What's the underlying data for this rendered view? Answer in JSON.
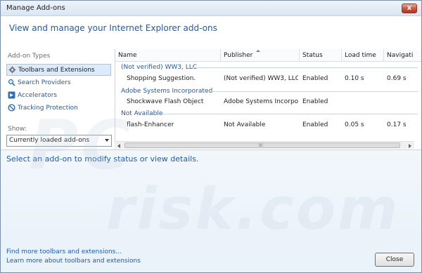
{
  "window": {
    "title": "Manage Add-ons",
    "close_glyph": "x"
  },
  "header": {
    "title": "View and manage your Internet Explorer add-ons"
  },
  "left_panel": {
    "types_label": "Add-on Types",
    "items": [
      {
        "label": "Toolbars and Extensions",
        "icon": "gear-icon",
        "selected": true
      },
      {
        "label": "Search Providers",
        "icon": "search-icon",
        "selected": false
      },
      {
        "label": "Accelerators",
        "icon": "accelerator-icon",
        "selected": false
      },
      {
        "label": "Tracking Protection",
        "icon": "block-icon",
        "selected": false
      }
    ],
    "show_label": "Show:",
    "show_select": "Currently loaded add-ons"
  },
  "list": {
    "columns": [
      "Name",
      "Publisher",
      "Status",
      "Load time",
      "Navigati"
    ],
    "groups": [
      {
        "name": "(Not verified) WW3, LLC",
        "rows": [
          {
            "name": "Shopping Suggestion.",
            "publisher": "(Not verified) WW3, LLC",
            "status": "Enabled",
            "load_time": "0.10 s",
            "navigation": "0.69 s"
          }
        ]
      },
      {
        "name": "Adobe Systems Incorporated",
        "rows": [
          {
            "name": "Shockwave Flash Object",
            "publisher": "Adobe Systems Incorpor...",
            "status": "Enabled",
            "load_time": "",
            "navigation": ""
          }
        ]
      },
      {
        "name": "Not Available",
        "rows": [
          {
            "name": "flash-Enhancer",
            "publisher": "Not Available",
            "status": "Enabled",
            "load_time": "0.05 s",
            "navigation": "0.17 s"
          }
        ]
      }
    ],
    "scroll_grip": "III"
  },
  "details": {
    "message": "Select an add-on to modify status or view details."
  },
  "watermark": {
    "logo": "PC",
    "text": "risk.com"
  },
  "footer": {
    "link1": "Find more toolbars and extensions...",
    "link2": "Learn more about toolbars and extensions",
    "close_label": "Close"
  },
  "colors": {
    "accent": "#1f5ba8",
    "details_bg": "#eaf2fa",
    "selection": "#dcebfb"
  }
}
